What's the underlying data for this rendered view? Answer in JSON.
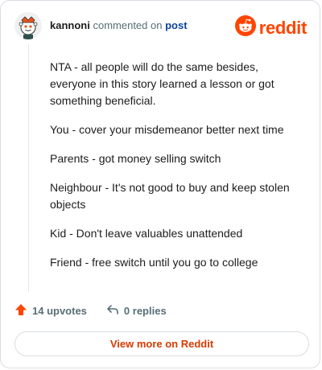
{
  "header": {
    "username": "kannoni",
    "action_text": "commented on",
    "post_link": "post",
    "logo_text": "reddit",
    "avatar_icon": "reddit-snoo-avatar-icon",
    "logo_icon": "reddit-snoo-logo-icon"
  },
  "comment": {
    "paragraphs": [
      "NTA - all people will do the same besides, everyone in this story learned a lesson or got something beneficial.",
      "You - cover your misdemeanor better next time",
      "Parents - got money selling switch",
      "Neighbour - It's not good to buy and keep stolen objects",
      "Kid - Don't leave valuables unattended",
      "Friend - free switch until you go to college"
    ]
  },
  "actions": {
    "upvotes_label": "14 upvotes",
    "replies_label": "0 replies",
    "upvote_icon": "upvote-arrow-icon",
    "reply_icon": "reply-arrow-icon"
  },
  "footer": {
    "view_more_label": "View more on Reddit"
  },
  "colors": {
    "brand": "#ff4500",
    "link": "#0a449b",
    "meta_text": "#576f76",
    "view_more_text": "#d93a00",
    "border": "#d9dde1"
  }
}
